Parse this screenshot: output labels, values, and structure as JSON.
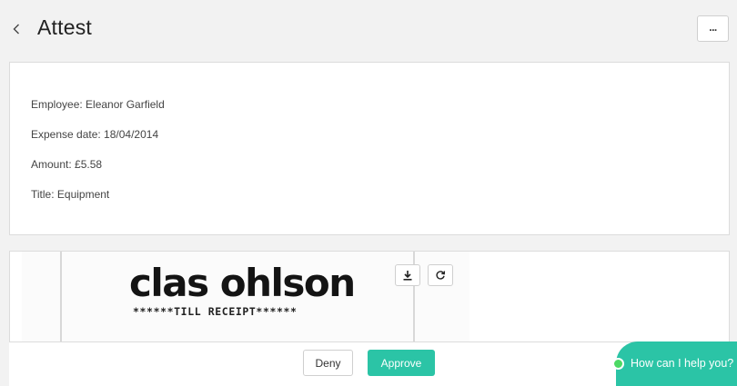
{
  "header": {
    "title": "Attest",
    "back_icon": "chevron-left-icon",
    "more_label": "..."
  },
  "details": {
    "employee": "Employee: Eleanor Garfield",
    "expense_date": "Expense date: 18/04/2014",
    "amount": "Amount: £5.58",
    "title": "Title: Equipment"
  },
  "receipt": {
    "logo_text": "clas ohlson",
    "sub_text": "******TILL RECEIPT******",
    "tools": [
      "download-icon",
      "rotate-icon"
    ]
  },
  "actions": {
    "deny_label": "Deny",
    "approve_label": "Approve"
  },
  "chat": {
    "label": "How can I help you?"
  },
  "colors": {
    "accent": "#2bc4a6",
    "online": "#4cd964",
    "background": "#f2f2f2"
  }
}
